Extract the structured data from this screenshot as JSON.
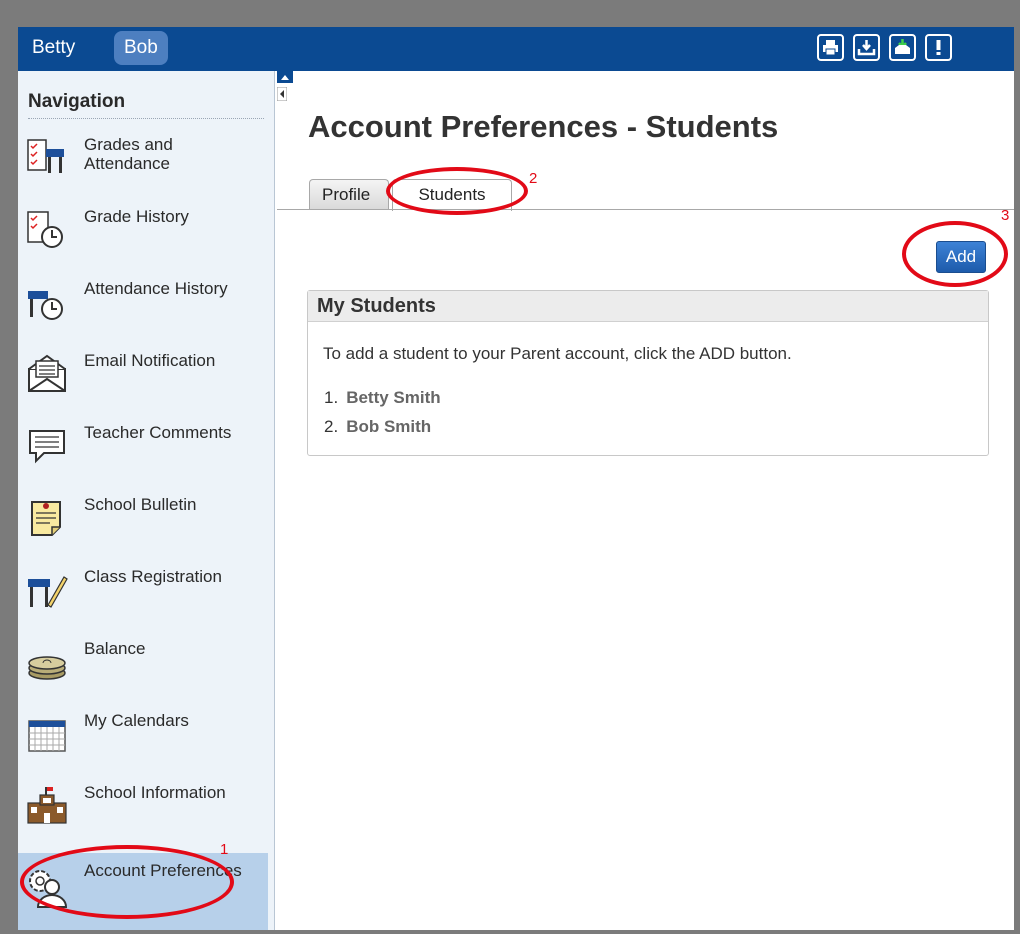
{
  "header": {
    "students": [
      "Betty",
      "Bob"
    ],
    "active_student": "Bob"
  },
  "toolbar": {
    "icons": [
      "printer-icon",
      "download-icon",
      "download-green-icon",
      "alert-icon"
    ]
  },
  "sidebar": {
    "title": "Navigation",
    "items": [
      {
        "label": "Grades and Attendance",
        "icon": "grades-attendance-icon"
      },
      {
        "label": "Grade History",
        "icon": "grade-history-icon"
      },
      {
        "label": "Attendance History",
        "icon": "attendance-history-icon"
      },
      {
        "label": "Email Notification",
        "icon": "email-icon"
      },
      {
        "label": "Teacher Comments",
        "icon": "comment-icon"
      },
      {
        "label": "School Bulletin",
        "icon": "bulletin-icon"
      },
      {
        "label": "Class Registration",
        "icon": "registration-icon"
      },
      {
        "label": "Balance",
        "icon": "coins-icon"
      },
      {
        "label": "My Calendars",
        "icon": "calendar-icon"
      },
      {
        "label": "School Information",
        "icon": "school-icon"
      },
      {
        "label": "Account Preferences",
        "icon": "account-gear-icon",
        "selected": true
      }
    ]
  },
  "main": {
    "title": "Account Preferences - Students",
    "tabs": [
      {
        "label": "Profile"
      },
      {
        "label": "Students",
        "active": true
      }
    ],
    "add_label": "Add",
    "panel": {
      "title": "My Students",
      "instructions": "To add a student to your Parent account, click the ADD button.",
      "students": [
        {
          "num": "1.",
          "name": "Betty Smith"
        },
        {
          "num": "2.",
          "name": "Bob Smith"
        }
      ]
    }
  },
  "annotations": {
    "marks": [
      "1",
      "2",
      "3"
    ],
    "color": "#e20a17"
  }
}
